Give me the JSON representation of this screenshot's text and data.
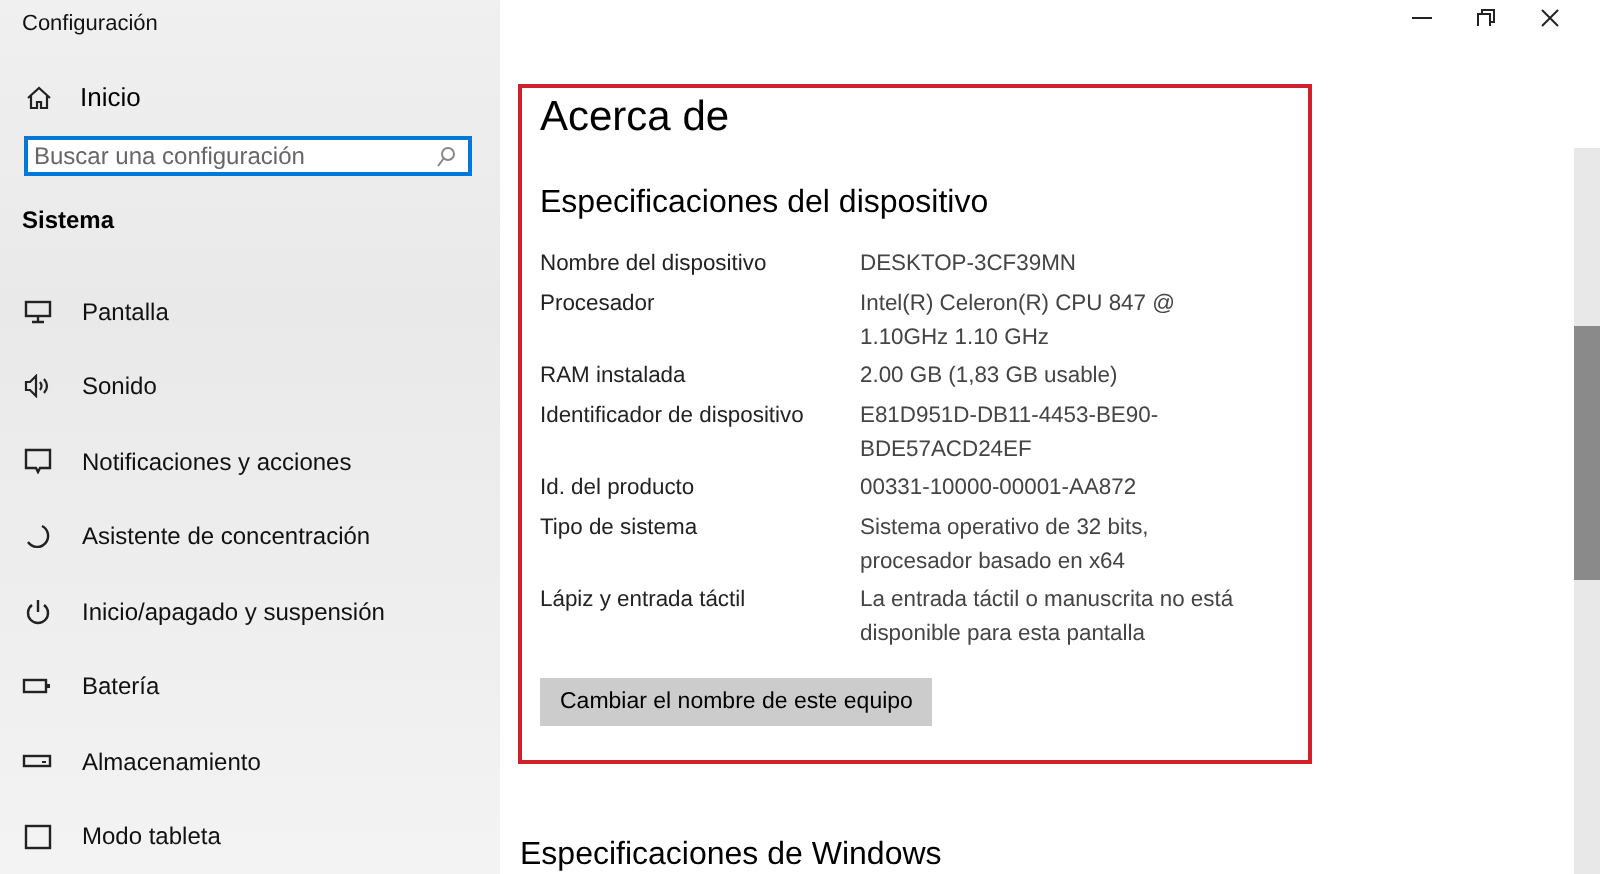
{
  "window": {
    "title": "Configuración"
  },
  "sidebar": {
    "home": {
      "label": "Inicio"
    },
    "search": {
      "placeholder": "Buscar una configuración"
    },
    "section": "Sistema",
    "items": [
      {
        "label": "Pantalla"
      },
      {
        "label": "Sonido"
      },
      {
        "label": "Notificaciones y acciones"
      },
      {
        "label": "Asistente de concentración"
      },
      {
        "label": "Inicio/apagado y suspensión"
      },
      {
        "label": "Batería"
      },
      {
        "label": "Almacenamiento"
      },
      {
        "label": "Modo tableta"
      }
    ]
  },
  "main": {
    "title": "Acerca de",
    "section": "Especificaciones del dispositivo",
    "specs": [
      {
        "label": "Nombre del dispositivo",
        "value": "DESKTOP-3CF39MN"
      },
      {
        "label": "Procesador",
        "value": "Intel(R) Celeron(R) CPU 847 @ 1.10GHz 1.10 GHz"
      },
      {
        "label": "RAM instalada",
        "value": "2.00 GB (1,83 GB usable)"
      },
      {
        "label": "Identificador de dispositivo",
        "value": "E81D951D-DB11-4453-BE90-BDE57ACD24EF"
      },
      {
        "label": "Id. del producto",
        "value": "00331-10000-00001-AA872"
      },
      {
        "label": "Tipo de sistema",
        "value": "Sistema operativo de 32 bits, procesador basado en x64"
      },
      {
        "label": "Lápiz y entrada táctil",
        "value": "La entrada táctil o manuscrita no está disponible para esta pantalla"
      }
    ],
    "rename_button": "Cambiar el nombre de este equipo",
    "next_section": "Especificaciones de Windows"
  }
}
